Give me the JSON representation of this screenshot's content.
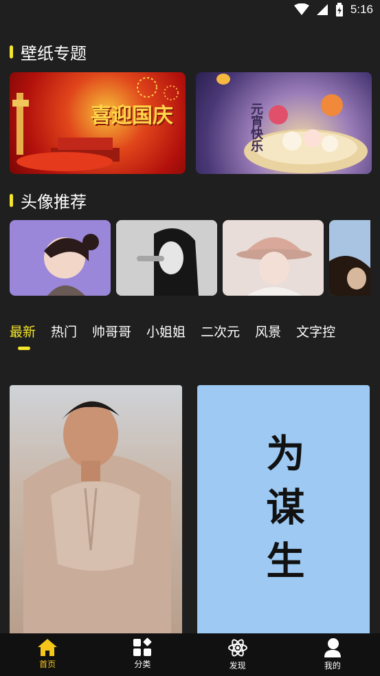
{
  "status": {
    "time": "5:16"
  },
  "sections": {
    "wallpaper_topics": "壁纸专题",
    "avatar_recommend": "头像推荐"
  },
  "banners": [
    {
      "text": "喜迎国庆"
    },
    {
      "text": "元宵快乐"
    }
  ],
  "tabs": [
    "最新",
    "热门",
    "帅哥哥",
    "小姐姐",
    "二次元",
    "风景",
    "文字控"
  ],
  "cards": [
    {
      "text": ""
    },
    {
      "text": "为谋生"
    }
  ],
  "bottom_nav": [
    {
      "label": "首页",
      "icon": "home-icon"
    },
    {
      "label": "分类",
      "icon": "category-icon"
    },
    {
      "label": "发现",
      "icon": "discover-icon"
    },
    {
      "label": "我的",
      "icon": "profile-icon"
    }
  ],
  "colors": {
    "accent": "#f5e62b",
    "active_nav": "#f5c71a",
    "background": "#1f1f1f"
  }
}
